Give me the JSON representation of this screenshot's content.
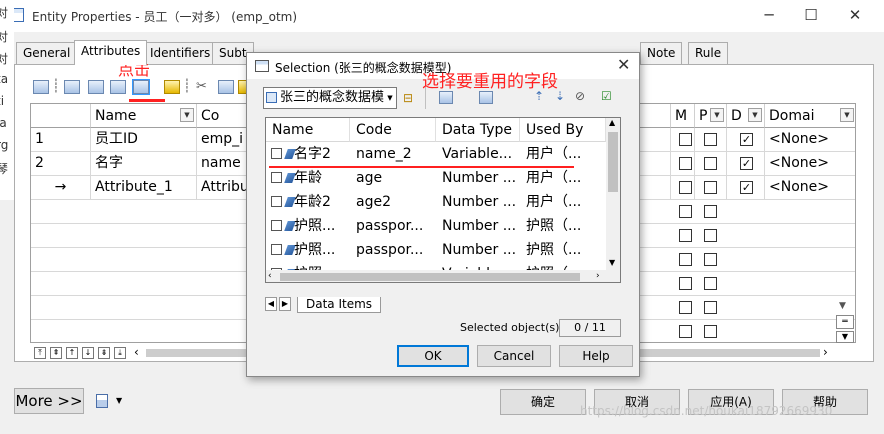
{
  "window": {
    "title": "Entity Properties - 员工（一对多） (emp_otm)",
    "minimize_glyph": "─",
    "maximize_glyph": "☐",
    "close_glyph": "✕"
  },
  "left_edge_fragments": [
    "对",
    "对",
    "对",
    "ta",
    "ti",
    "la",
    "rg",
    "琴"
  ],
  "tabs": [
    {
      "label": "General"
    },
    {
      "label": "Attributes",
      "active": true
    },
    {
      "label": "Identifiers"
    },
    {
      "label": "Subt"
    },
    {
      "label": "Note"
    },
    {
      "label": "Rule"
    }
  ],
  "annotations": {
    "click_hint": "点击",
    "select_hint": "选择要重用的字段"
  },
  "grid": {
    "columns": [
      {
        "label": "",
        "key": "num"
      },
      {
        "label": "Name",
        "key": "name"
      },
      {
        "label": "Co",
        "key": "code"
      },
      {
        "label": "Domai",
        "key": "domain"
      }
    ],
    "flag_columns": [
      "M",
      "P",
      "D"
    ],
    "rows": [
      {
        "num": "1",
        "name": "员工ID",
        "code": "emp_i",
        "m": false,
        "p": false,
        "d": true,
        "domain": "<None>"
      },
      {
        "num": "2",
        "name": "名字",
        "code": "name",
        "m": false,
        "p": false,
        "d": true,
        "domain": "<None>"
      },
      {
        "num": "→",
        "name": "Attribute_1",
        "code": "Attribu",
        "m": false,
        "p": false,
        "d": true,
        "domain": "<None>"
      }
    ]
  },
  "buttons": {
    "more": "More >>",
    "ok_cn": "确定",
    "cancel_cn": "取消",
    "apply_cn": "应用(A)",
    "help_cn": "帮助"
  },
  "watermark": "https://blog.csdn.net/houkai18792669930",
  "selection_dialog": {
    "title": "Selection (张三的概念数据模型)",
    "close_glyph": "✕",
    "model_select_value": "张三的概念数据模型",
    "list_columns": [
      "Name",
      "Code",
      "Data Type",
      "Used By",
      "e"
    ],
    "items": [
      {
        "name": "名字2",
        "code": "name_2",
        "type": "Variable...",
        "used_by": "用户（..."
      },
      {
        "name": "年龄",
        "code": "age",
        "type": "Number ...",
        "used_by": "用户（..."
      },
      {
        "name": "年龄2",
        "code": "age2",
        "type": "Number ...",
        "used_by": "用户（..."
      },
      {
        "name": "护照...",
        "code": "passpor...",
        "type": "Number ...",
        "used_by": "护照（..."
      },
      {
        "name": "护照...",
        "code": "passpor...",
        "type": "Number ...",
        "used_by": "护照（..."
      },
      {
        "name": "护照...",
        "code": "passpor...",
        "type": "Variable...",
        "used_by": "护照（..."
      }
    ],
    "tab_label": "Data Items",
    "selected_label": "Selected object(s):",
    "selected_count": "0 / 11",
    "ok": "OK",
    "cancel": "Cancel",
    "help": "Help"
  }
}
